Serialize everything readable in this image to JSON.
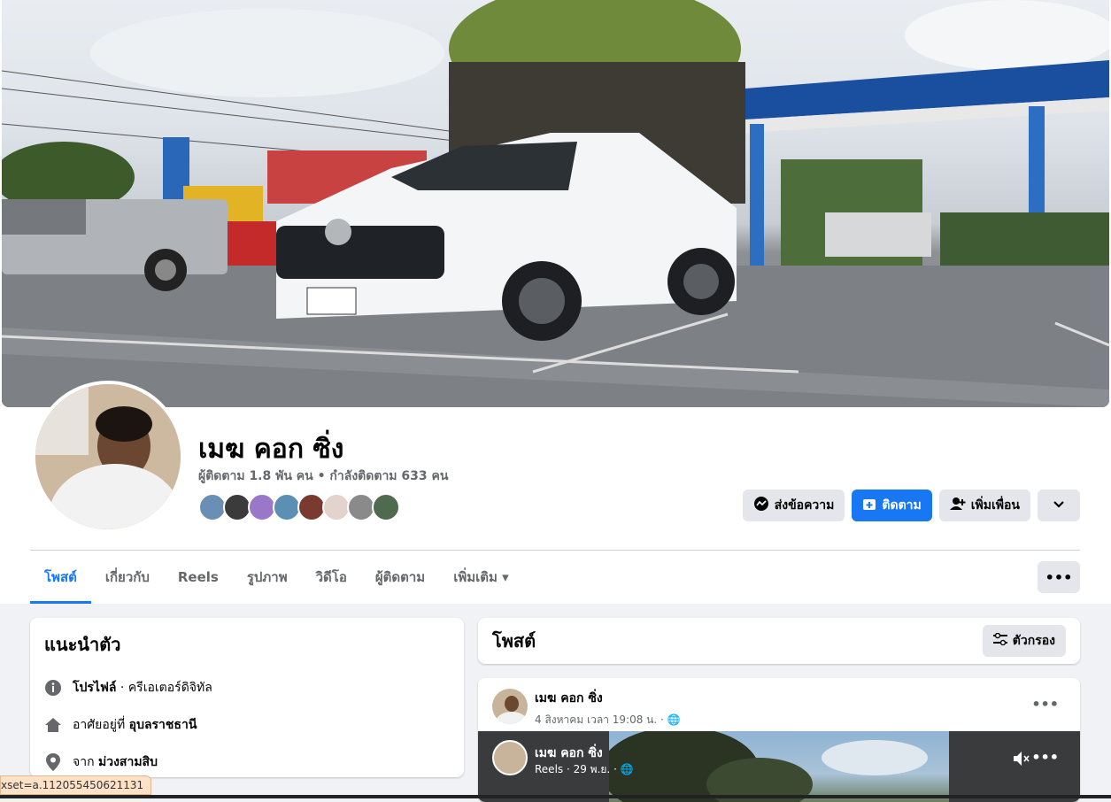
{
  "profile": {
    "name": "เมฆ คอก ซิ่ง",
    "stats": "ผู้ติดตาม 1.8 พัน คน • กำลังติดตาม 633 คน"
  },
  "actions": {
    "message": "ส่งข้อความ",
    "follow": "ติดตาม",
    "add_friend": "เพิ่มเพื่อน"
  },
  "tabs": [
    {
      "label": "โพสต์"
    },
    {
      "label": "เกี่ยวกับ"
    },
    {
      "label": "Reels"
    },
    {
      "label": "รูปภาพ"
    },
    {
      "label": "วิดีโอ"
    },
    {
      "label": "ผู้ติดตาม"
    },
    {
      "label": "เพิ่มเติม ▾"
    }
  ],
  "intro": {
    "title": "แนะนำตัว",
    "profile_bold": "โปรไฟล์",
    "profile_rest": " · ครีเอเตอร์ดิจิทัล",
    "lives_prefix": "อาศัยอยู่ที่ ",
    "lives_place": "อุบลราชธานี",
    "from_prefix": "จาก ",
    "from_place": "ม่วงสามสิบ"
  },
  "posts": {
    "title": "โพสต์",
    "filter": "ตัวกรอง"
  },
  "post": {
    "author": "เมฆ คอก ซิ่ง",
    "time": "4 สิงหาคม เวลา 19:08 น. · 🌐",
    "reel_author": "เมฆ คอก ซิ่ง",
    "reel_time": "Reels · 29 พ.ย. · 🌐"
  },
  "url_tooltip": "xset=a.112055450621131",
  "colors": {
    "accent": "#1877f2"
  }
}
